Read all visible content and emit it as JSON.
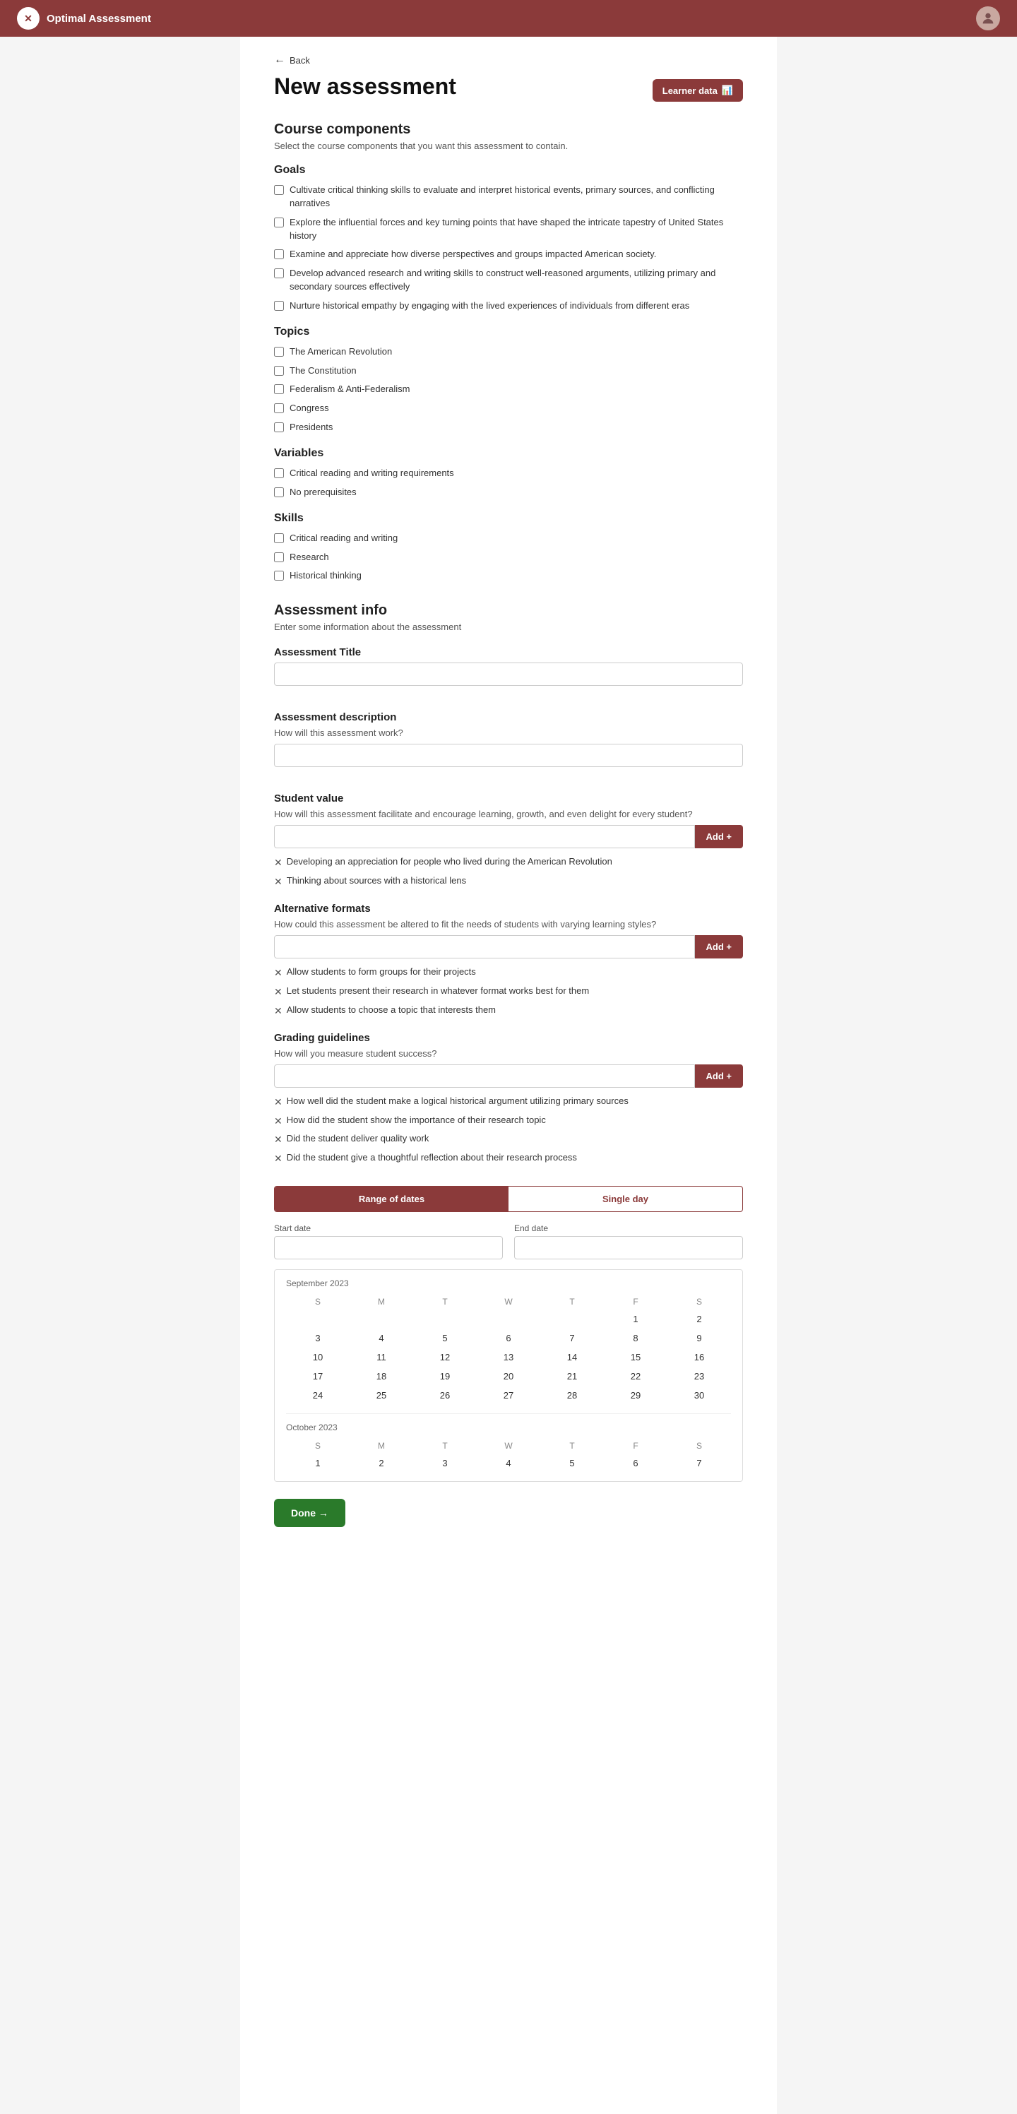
{
  "navbar": {
    "brand": "Optimal Assessment",
    "logo_text": "✕",
    "avatar_text": "👤"
  },
  "back_link": "Back",
  "page_title": "New assessment",
  "learner_data_btn": "Learner data",
  "course_components": {
    "title": "Course components",
    "subtitle": "Select the course components that you want this assessment to contain.",
    "goals": {
      "title": "Goals",
      "items": [
        "Cultivate critical thinking skills to evaluate and interpret historical events, primary sources, and conflicting narratives",
        "Explore the influential forces and key turning points that have shaped the intricate tapestry of United States history",
        "Examine and appreciate how diverse perspectives and groups impacted American society.",
        "Develop advanced research and writing skills to construct well-reasoned arguments, utilizing primary and secondary sources effectively",
        "Nurture historical empathy by engaging with the lived experiences of individuals from different eras"
      ]
    },
    "topics": {
      "title": "Topics",
      "items": [
        "The American Revolution",
        "The Constitution",
        "Federalism & Anti-Federalism",
        "Congress",
        "Presidents"
      ]
    },
    "variables": {
      "title": "Variables",
      "items": [
        "Critical reading and writing requirements",
        "No prerequisites"
      ]
    },
    "skills": {
      "title": "Skills",
      "items": [
        "Critical reading and writing",
        "Research",
        "Historical thinking"
      ]
    }
  },
  "assessment_info": {
    "title": "Assessment info",
    "subtitle": "Enter some information about the assessment",
    "title_label": "Assessment Title",
    "title_placeholder": "",
    "desc_label": "Assessment description",
    "desc_sublabel": "How will this assessment work?",
    "desc_placeholder": "",
    "student_value": {
      "label": "Student value",
      "sublabel": "How will this assessment facilitate and encourage learning, growth, and even delight for every student?",
      "placeholder": "",
      "add_label": "Add  +",
      "items": [
        "Developing an appreciation for people who lived during the American Revolution",
        "Thinking about sources with a historical lens"
      ]
    },
    "alt_formats": {
      "label": "Alternative formats",
      "sublabel": "How could this assessment be altered to fit the needs of students with varying learning styles?",
      "placeholder": "",
      "add_label": "Add  +",
      "items": [
        "Allow students to form groups for their projects",
        "Let students present their research in whatever format works best for them",
        "Allow students to choose a topic that interests them"
      ]
    },
    "grading": {
      "label": "Grading guidelines",
      "sublabel": "How will you measure student success?",
      "placeholder": "",
      "add_label": "Add  +",
      "items": [
        "How well did the student make a logical historical argument utilizing primary sources",
        "How did the student show the importance of their research topic",
        "Did the student deliver quality work",
        "Did the student give a thoughtful reflection about their research process"
      ]
    }
  },
  "date_picker": {
    "tab_range": "Range of dates",
    "tab_single": "Single day",
    "start_label": "Start date",
    "end_label": "End date",
    "calendar": {
      "months": [
        {
          "label": "September 2023",
          "days_of_week": [
            "S",
            "M",
            "T",
            "W",
            "T",
            "F",
            "S"
          ],
          "weeks": [
            [
              "",
              "",
              "",
              "",
              "",
              "1",
              "2"
            ],
            [
              "3",
              "4",
              "5",
              "6",
              "7",
              "8",
              "9"
            ],
            [
              "10",
              "11",
              "12",
              "13",
              "14",
              "15",
              "16"
            ],
            [
              "17",
              "18",
              "19",
              "20",
              "21",
              "22",
              "23"
            ],
            [
              "24",
              "25",
              "26",
              "27",
              "28",
              "29",
              "30"
            ]
          ]
        },
        {
          "label": "October 2023",
          "days_of_week": [
            "S",
            "M",
            "T",
            "W",
            "T",
            "F",
            "S"
          ],
          "weeks": [
            [
              "1",
              "2",
              "3",
              "4",
              "5",
              "6",
              "7"
            ]
          ]
        }
      ]
    }
  },
  "done_btn": "Done →"
}
